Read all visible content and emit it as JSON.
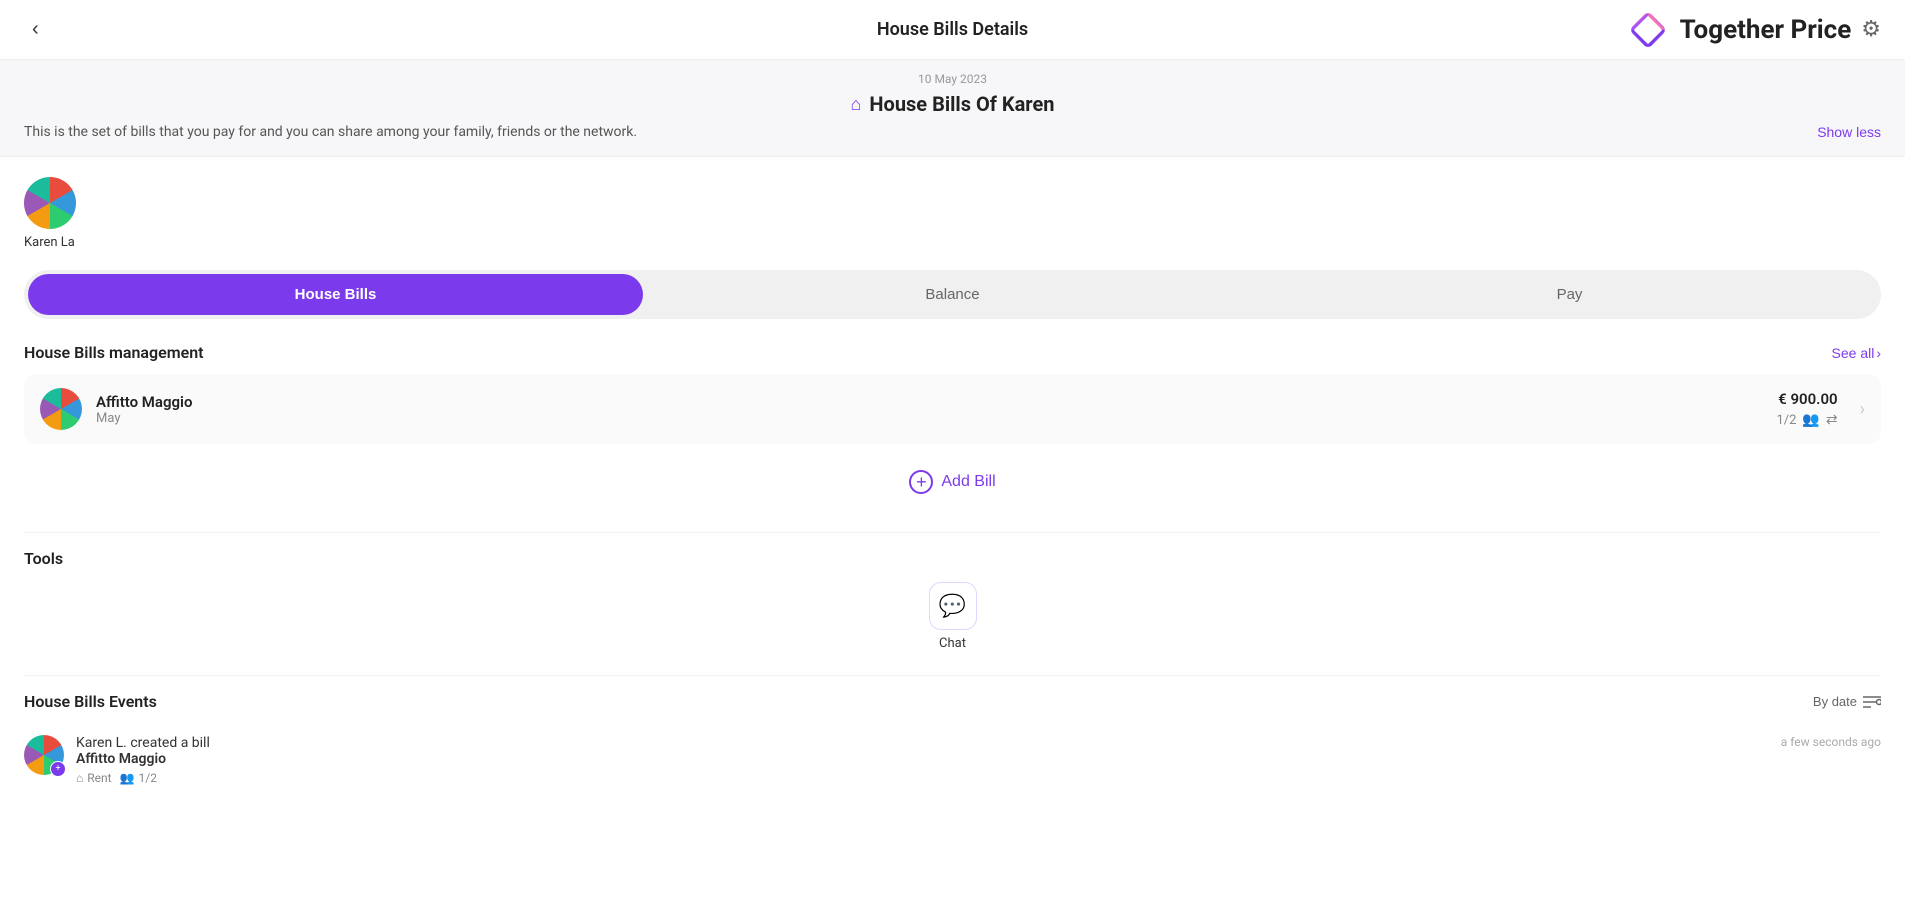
{
  "header": {
    "back_label": "‹",
    "title": "House Bills Details",
    "logo_text": "Together Price",
    "gear_label": "⚙"
  },
  "info_banner": {
    "date": "10 May 2023",
    "title": "House Bills Of Karen",
    "description": "This is the set of bills that you pay for and you can share among your family, friends or the network.",
    "show_less_label": "Show less",
    "home_icon": "⌂"
  },
  "user": {
    "name": "Karen La"
  },
  "tabs": [
    {
      "id": "house-bills",
      "label": "House Bills",
      "active": true
    },
    {
      "id": "balance",
      "label": "Balance",
      "active": false
    },
    {
      "id": "pay",
      "label": "Pay",
      "active": false
    }
  ],
  "management": {
    "title": "House Bills management",
    "see_all_label": "See all",
    "bills": [
      {
        "name": "Affitto Maggio",
        "date": "May",
        "amount": "€ 900.00",
        "members": "1/2"
      }
    ]
  },
  "add_bill": {
    "label": "Add Bill",
    "icon": "+"
  },
  "tools": {
    "title": "Tools",
    "items": [
      {
        "id": "chat",
        "label": "Chat",
        "icon": "💬"
      }
    ]
  },
  "events": {
    "title": "House Bills Events",
    "filter_label": "By date",
    "items": [
      {
        "description": "Karen L. created a bill",
        "name": "Affitto Maggio",
        "tags": [
          {
            "icon": "⌂",
            "label": "Rent"
          },
          {
            "icon": "👥",
            "label": "1/2"
          }
        ],
        "time": "a few seconds ago"
      }
    ]
  }
}
